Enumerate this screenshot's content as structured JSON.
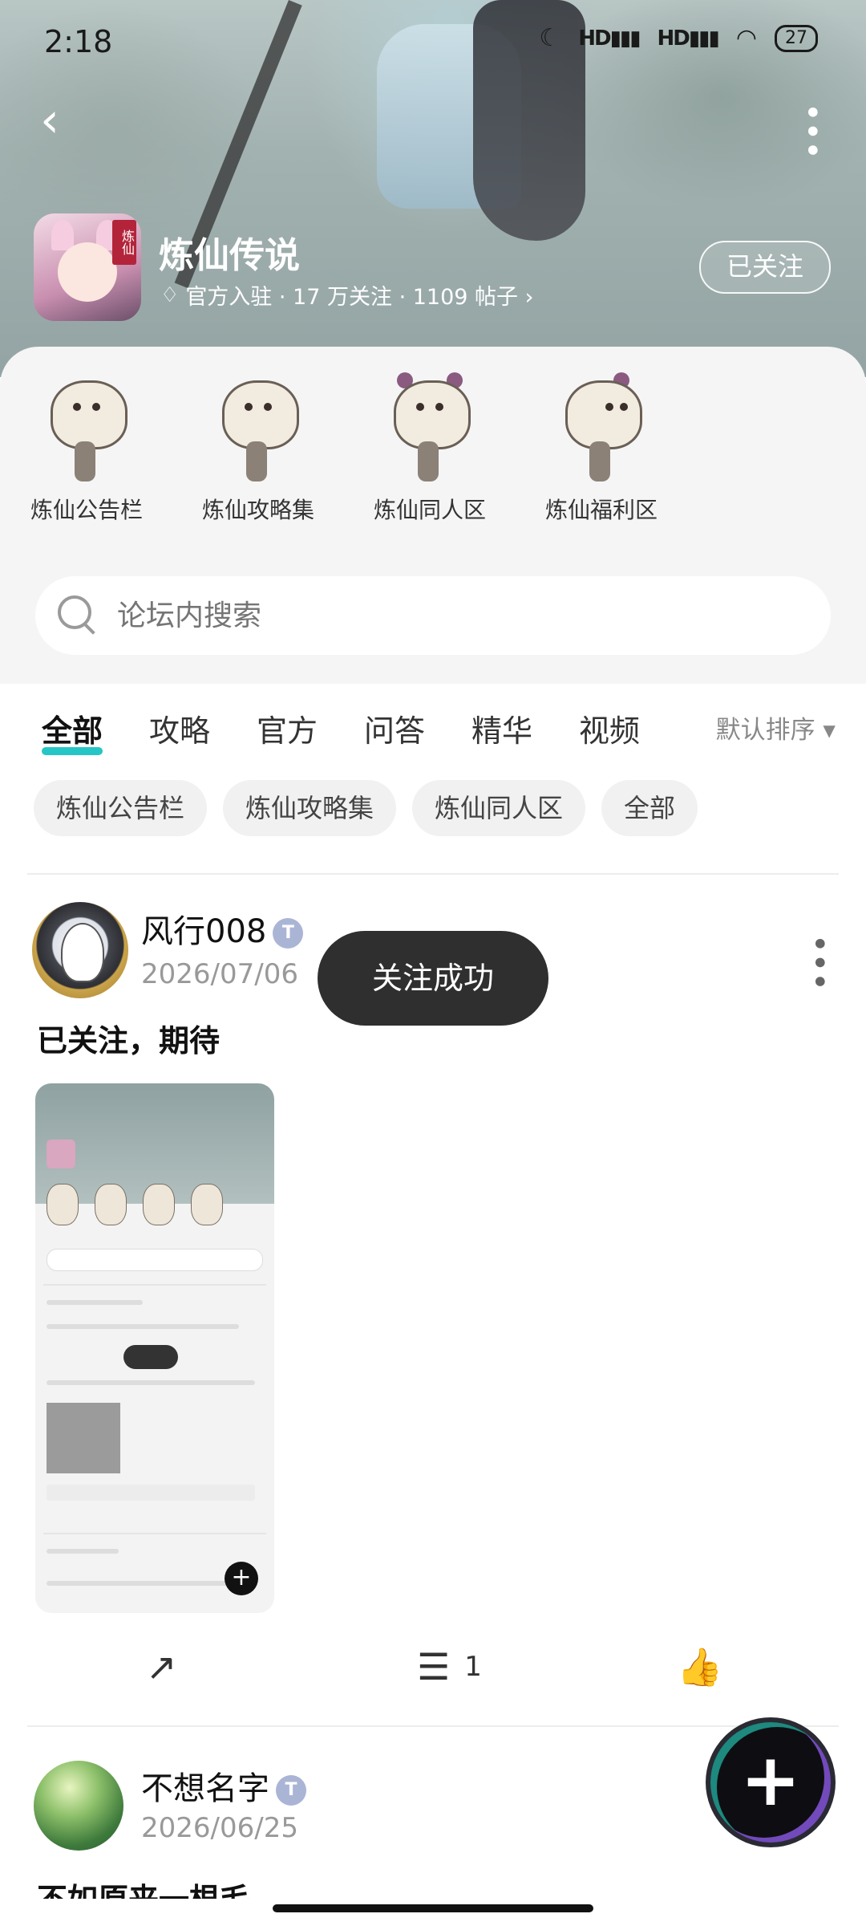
{
  "status_bar": {
    "time": "2:18",
    "net1": "HD",
    "net2": "HD",
    "battery": "27"
  },
  "header": {
    "back_icon": "chevron-left-icon",
    "more_icon": "vertical-dots-icon",
    "forum_name": "炼仙传说",
    "meta": "官方入驻 · 17 万关注 · 1109 帖子 ›",
    "follow_label": "已关注"
  },
  "subforums": [
    {
      "label": "炼仙公告栏"
    },
    {
      "label": "炼仙攻略集"
    },
    {
      "label": "炼仙同人区"
    },
    {
      "label": "炼仙福利区"
    }
  ],
  "search": {
    "placeholder": "论坛内搜索"
  },
  "tabs": [
    {
      "label": "全部",
      "active": true
    },
    {
      "label": "攻略"
    },
    {
      "label": "官方"
    },
    {
      "label": "问答"
    },
    {
      "label": "精华"
    },
    {
      "label": "视频"
    }
  ],
  "sort": {
    "label": "默认排序 ▾"
  },
  "chips": [
    {
      "label": "炼仙公告栏"
    },
    {
      "label": "炼仙攻略集"
    },
    {
      "label": "炼仙同人区"
    },
    {
      "label": "全部"
    }
  ],
  "posts": [
    {
      "author": "风行008",
      "date": "2026/07/06",
      "text": "已关注，期待",
      "comments": "1"
    },
    {
      "author": "不想名字",
      "date": "2026/06/25",
      "text": "不如原来一根毛"
    }
  ],
  "toast": {
    "text": "关注成功"
  },
  "accent_color": "#26c6c6"
}
